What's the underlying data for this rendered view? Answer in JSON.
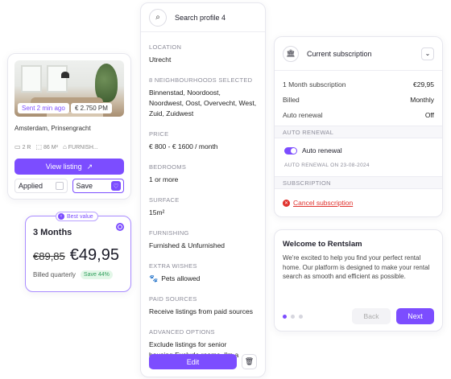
{
  "listing": {
    "sent_badge": "Sent 2 min ago",
    "price_badge": "€ 2.750 PM",
    "address": "Amsterdam, Prinsengracht",
    "rooms": "2 R",
    "size": "86 M²",
    "furnished": "FURNISH...",
    "view_label": "View listing",
    "applied_label": "Applied",
    "save_label": "Save"
  },
  "pricing": {
    "best_value": "Best value",
    "months": "3 Months",
    "old_price": "€89,85",
    "new_price": "€49,95",
    "billed": "Billed quarterly",
    "save_badge": "Save 44%"
  },
  "search_profile": {
    "title": "Search profile 4",
    "sections": [
      {
        "label": "LOCATION",
        "value": "Utrecht"
      },
      {
        "label": "8 NEIGHBOURHOODS SELECTED",
        "value": "Binnenstad, Noordoost, Noordwest, Oost, Overvecht, West, Zuid, Zuidwest"
      },
      {
        "label": "PRICE",
        "value": "€ 800 - € 1600 / month"
      },
      {
        "label": "BEDROOMS",
        "value": "1 or more"
      },
      {
        "label": "SURFACE",
        "value": "15m²"
      },
      {
        "label": "FURNISHING",
        "value": "Furnished & Unfurnished"
      },
      {
        "label": "EXTRA WISHES",
        "value": "Pets allowed"
      },
      {
        "label": "PAID SOURCES",
        "value": "Receive listings from paid sources"
      },
      {
        "label": "ADVANCED OPTIONS",
        "value": "Exclude listings for senior housing,Exclude rooms, I'm a student, Suitable for sharing"
      }
    ],
    "edit_label": "Edit"
  },
  "subscription": {
    "title": "Current subscription",
    "rows": [
      {
        "k": "1 Month subscription",
        "v": "€29,95"
      },
      {
        "k": "Billed",
        "v": "Monthly"
      },
      {
        "k": "Auto renewal",
        "v": "Off"
      }
    ],
    "auto_renewal_band": "AUTO RENEWAL",
    "toggle_label": "Auto renewal",
    "renew_date": "AUTO RENEWAL ON 23-08-2024",
    "subscription_band": "SUBSCRIPTION",
    "cancel_label": "Cancel subscription"
  },
  "welcome": {
    "title": "Welcome to Rentslam",
    "body": "We're excited to help you find your perfect rental home. Our platform is designed to make your rental search as smooth and efficient as possible.",
    "back_label": "Back",
    "next_label": "Next"
  },
  "colors": {
    "accent": "#7c4dff",
    "danger": "#e0322d",
    "success": "#2e9e5b"
  }
}
